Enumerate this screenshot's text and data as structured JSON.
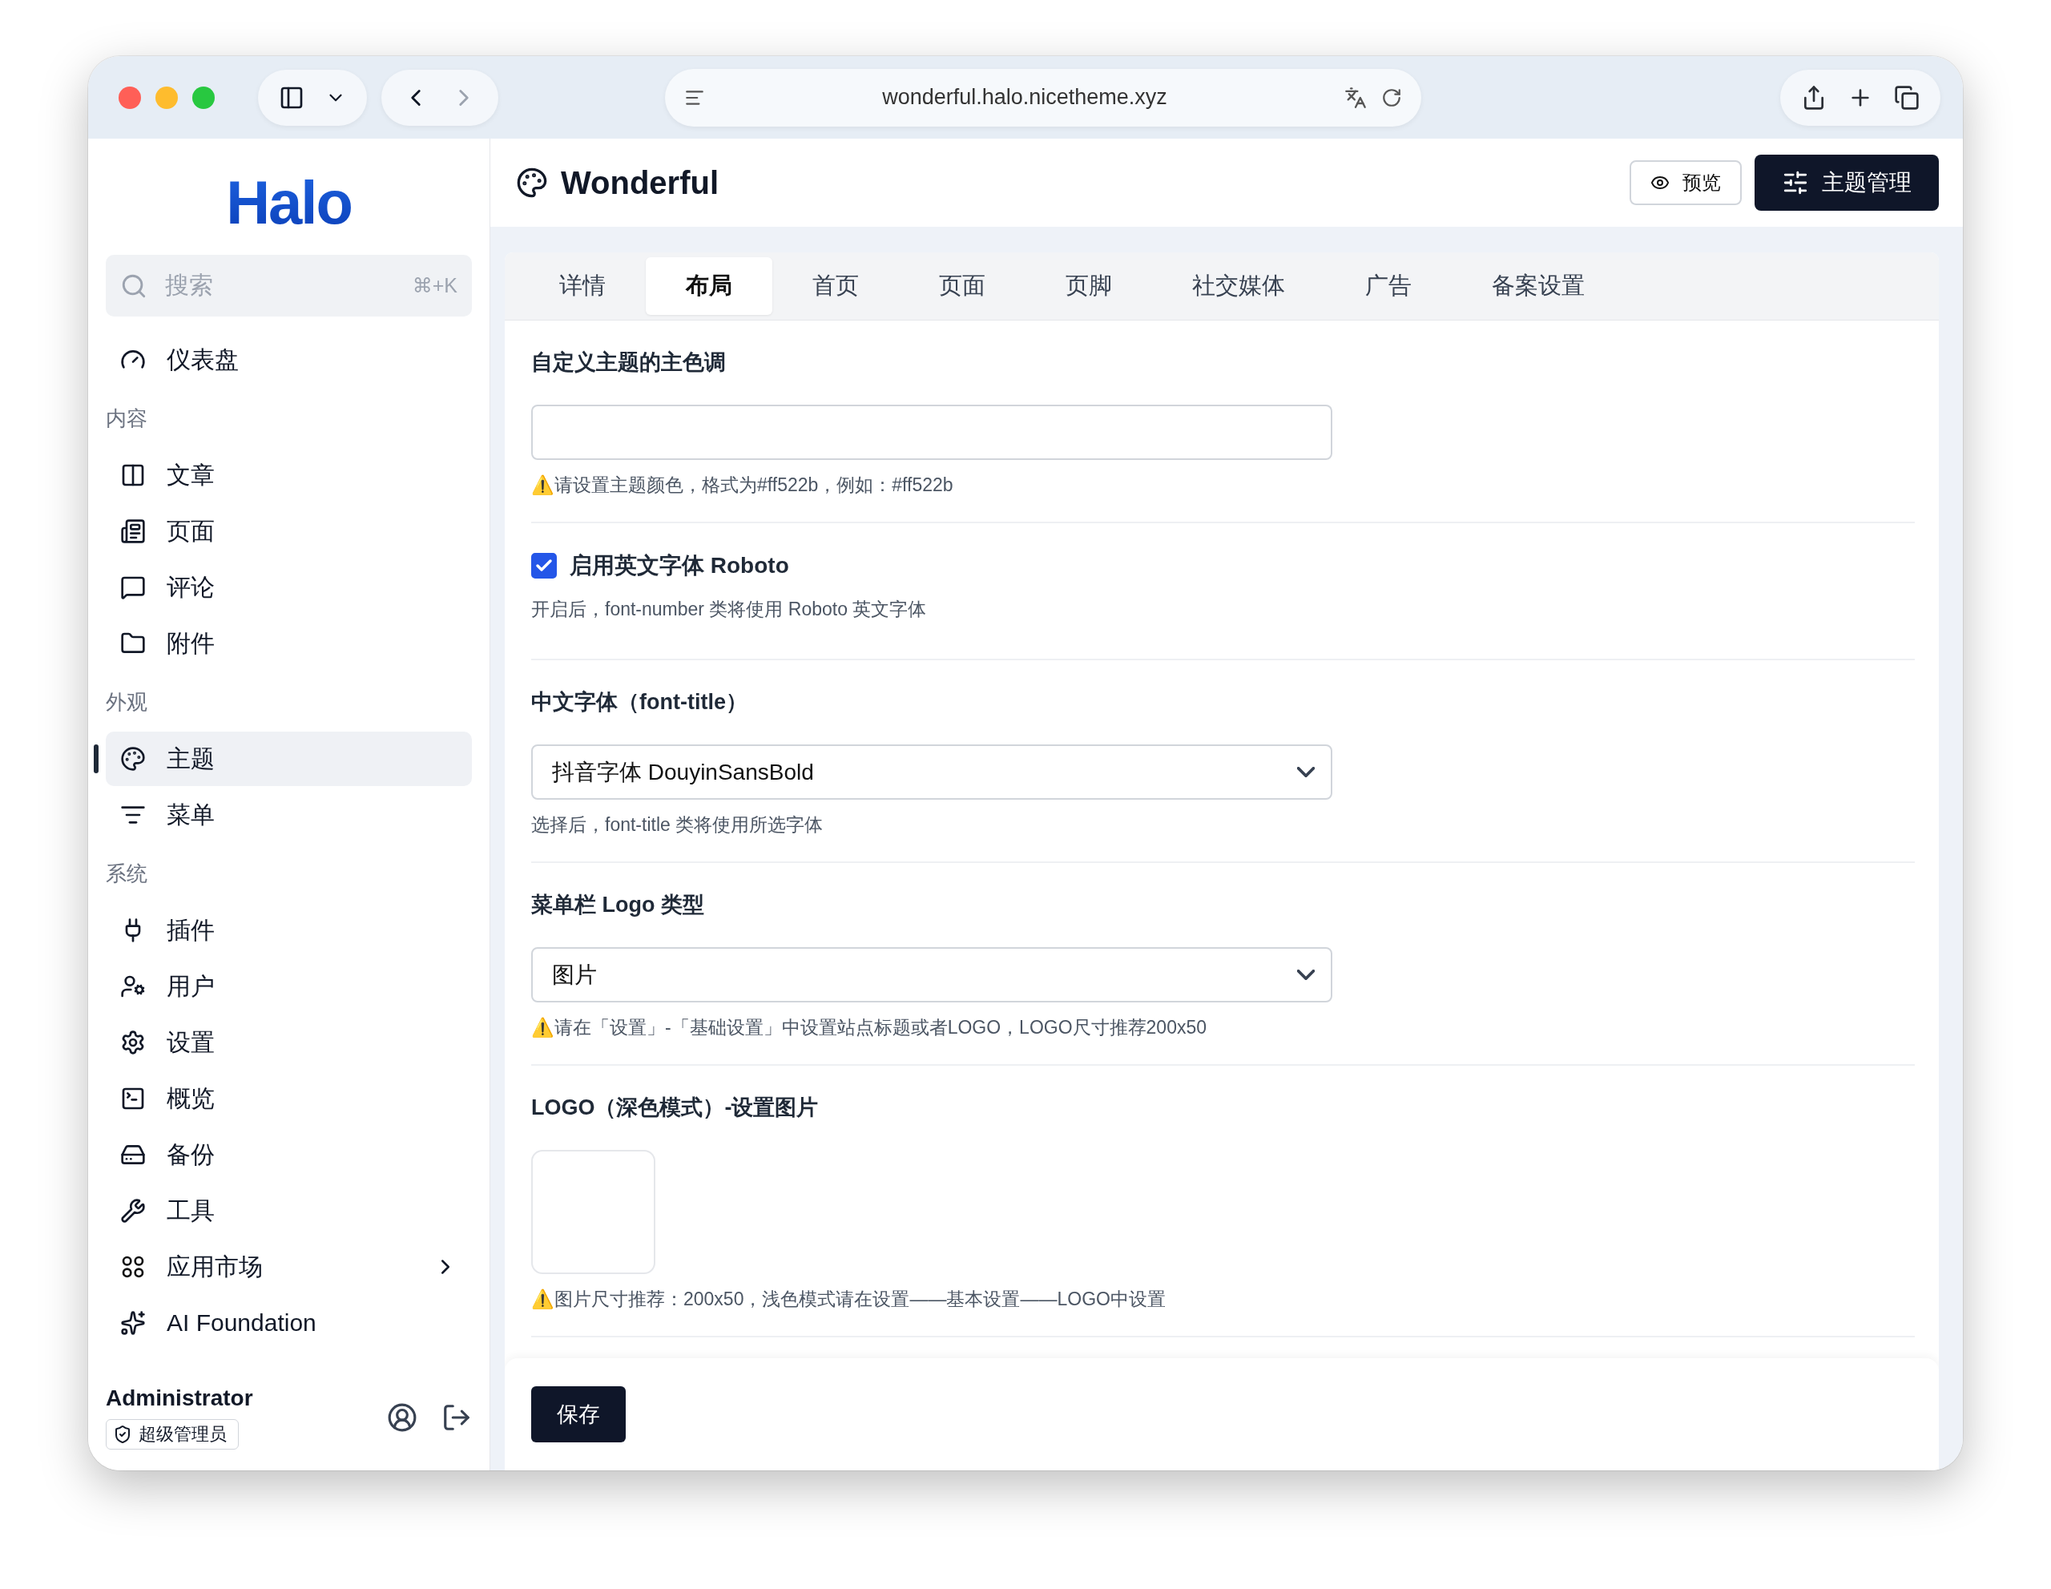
{
  "browser": {
    "url": "wonderful.halo.nicetheme.xyz"
  },
  "sidebar": {
    "logo": "Halo",
    "search": {
      "placeholder": "搜索",
      "shortcut": "⌘+K"
    },
    "sections": [
      {
        "items": [
          {
            "label": "仪表盘",
            "selected": false,
            "submenu": false
          }
        ]
      },
      {
        "title": "内容",
        "items": [
          {
            "label": "文章",
            "selected": false,
            "submenu": false
          },
          {
            "label": "页面",
            "selected": false,
            "submenu": false
          },
          {
            "label": "评论",
            "selected": false,
            "submenu": false
          },
          {
            "label": "附件",
            "selected": false,
            "submenu": false
          }
        ]
      },
      {
        "title": "外观",
        "items": [
          {
            "label": "主题",
            "selected": true,
            "submenu": false
          },
          {
            "label": "菜单",
            "selected": false,
            "submenu": false
          }
        ]
      },
      {
        "title": "系统",
        "items": [
          {
            "label": "插件",
            "selected": false,
            "submenu": false
          },
          {
            "label": "用户",
            "selected": false,
            "submenu": false
          },
          {
            "label": "设置",
            "selected": false,
            "submenu": false
          },
          {
            "label": "概览",
            "selected": false,
            "submenu": false
          },
          {
            "label": "备份",
            "selected": false,
            "submenu": false
          },
          {
            "label": "工具",
            "selected": false,
            "submenu": false
          },
          {
            "label": "应用市场",
            "selected": false,
            "submenu": true
          },
          {
            "label": "AI Foundation",
            "selected": false,
            "submenu": false
          }
        ]
      }
    ],
    "user": {
      "name": "Administrator",
      "role": "超级管理员"
    }
  },
  "header": {
    "title": "Wonderful",
    "buttons": [
      {
        "label": "预览",
        "kind": "outline"
      },
      {
        "label": "主题管理",
        "kind": "primary"
      }
    ]
  },
  "tabs": [
    {
      "label": "详情",
      "selected": false
    },
    {
      "label": "布局",
      "selected": true
    },
    {
      "label": "首页",
      "selected": false
    },
    {
      "label": "页面",
      "selected": false
    },
    {
      "label": "页脚",
      "selected": false
    },
    {
      "label": "社交媒体",
      "selected": false
    },
    {
      "label": "广告",
      "selected": false
    },
    {
      "label": "备案设置",
      "selected": false
    }
  ],
  "fields": [
    {
      "kind": "text",
      "label": "自定义主题的主色调",
      "help": "⚠️请设置主题颜色，格式为#ff522b，例如：#ff522b"
    },
    {
      "kind": "checkbox",
      "label": "启用英文字体 Roboto",
      "checked": true,
      "help": "开启后，font-number 类将使用 Roboto 英文字体"
    },
    {
      "kind": "select",
      "label": "中文字体（font-title）",
      "value": "抖音字体 DouyinSansBold",
      "help": "选择后，font-title 类将使用所选字体"
    },
    {
      "kind": "select",
      "label": "菜单栏 Logo 类型",
      "value": "图片",
      "help": "⚠️请在「设置」-「基础设置」中设置站点标题或者LOGO，LOGO尺寸推荐200x50"
    },
    {
      "kind": "image",
      "label": "LOGO（深色模式）-设置图片",
      "help": "⚠️图片尺寸推荐：200x50，浅色模式请在设置——基本设置——LOGO中设置"
    }
  ],
  "save_button": "保存"
}
